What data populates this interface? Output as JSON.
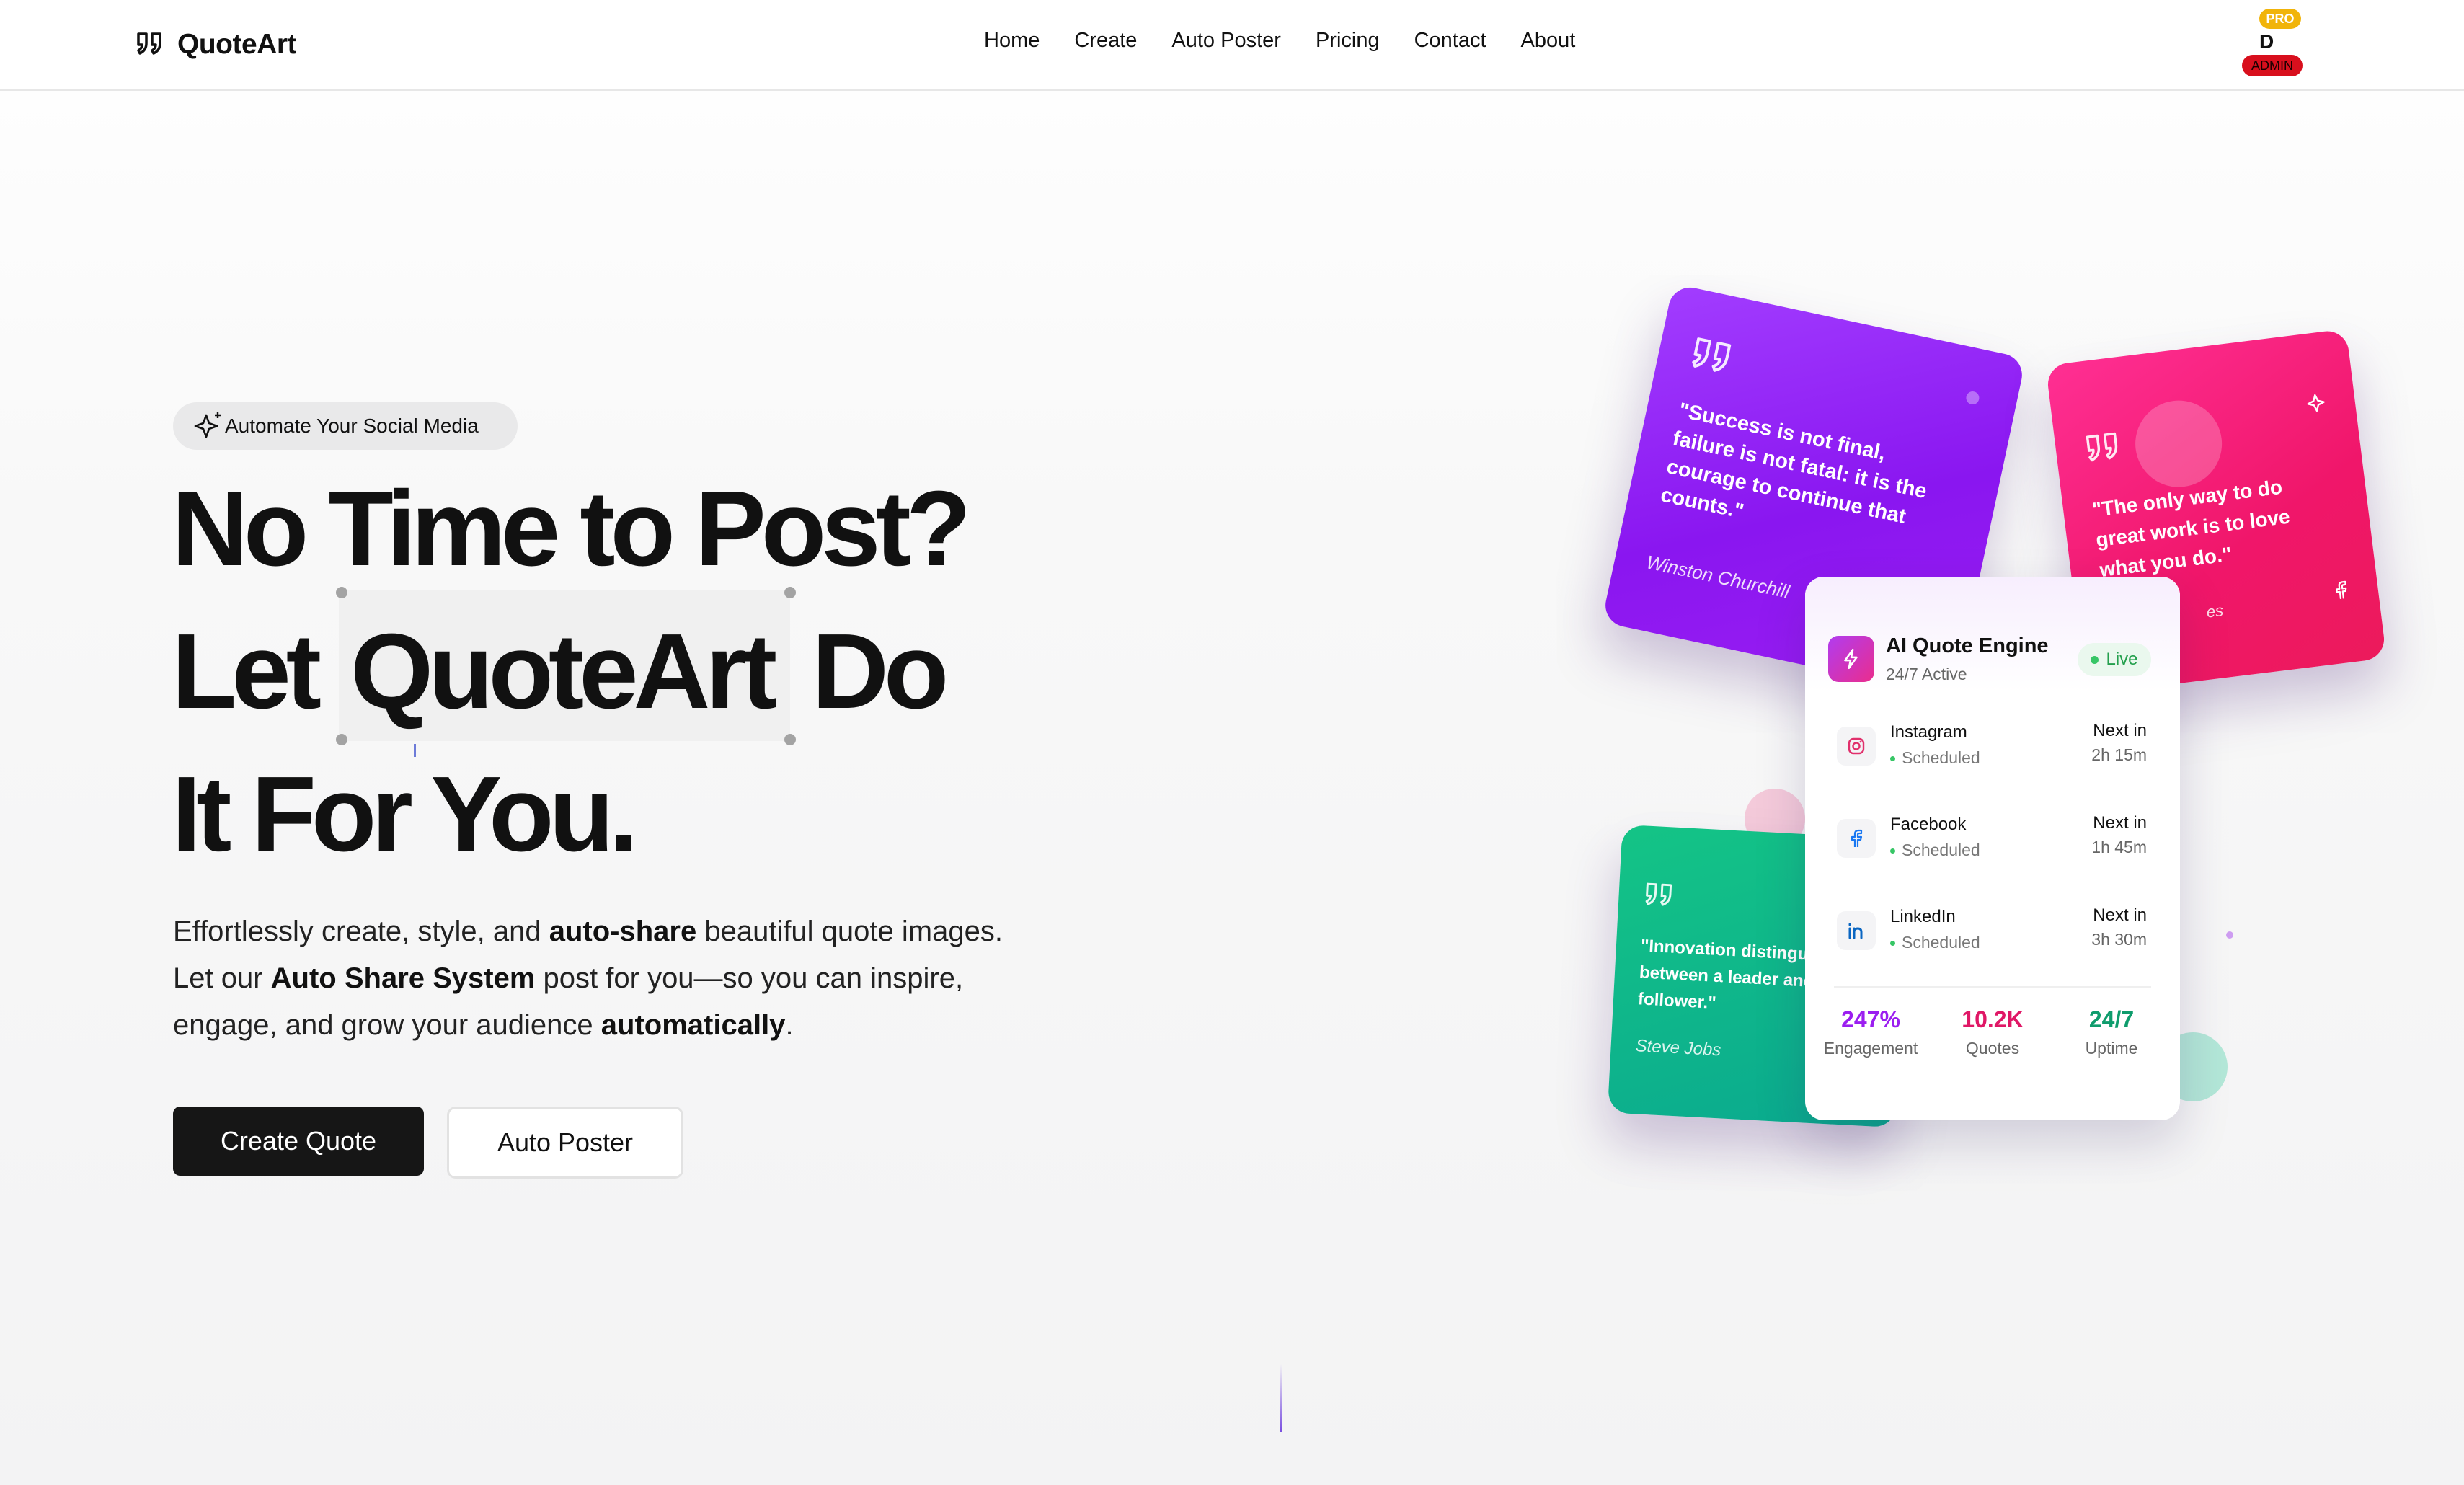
{
  "nav": {
    "brand": "QuoteArt",
    "links": [
      "Home",
      "Create",
      "Auto Poster",
      "Pricing",
      "Contact",
      "About"
    ],
    "user": {
      "pro_badge": "PRO",
      "initial": "D",
      "admin_badge": "ADMIN"
    }
  },
  "hero": {
    "eyebrow": "Automate Your Social Media",
    "headline_line1": "No Time to Post?",
    "headline_let": "Let",
    "headline_brand": "QuoteArt",
    "headline_do": "Do",
    "headline_line3": "It For You.",
    "description": {
      "p1": "Effortlessly create, style, and ",
      "b1": "auto-share",
      "p2": " beautiful quote images.",
      "p3": "Let our ",
      "b2": "Auto Share System",
      "p4": " post for you—so you can inspire,",
      "p5": "engage, and grow your audience ",
      "b3": "automatically",
      "p6": "."
    },
    "cta_primary": "Create Quote",
    "cta_secondary": "Auto Poster"
  },
  "cards": {
    "purple": {
      "quote": "\"Success is not final, failure is not fatal: it is the courage to continue that counts.\"",
      "author": "Winston Churchill"
    },
    "pink": {
      "quote": "\"The only way to do great work is to love what you do.\"",
      "author": "es"
    },
    "green": {
      "quote": "\"Innovation distinguishes between a leader and a follower.\"",
      "author": "Steve Jobs"
    }
  },
  "engine": {
    "title": "AI Quote Engine",
    "subtitle": "24/7 Active",
    "status": "Live",
    "schedules": [
      {
        "platform": "Instagram",
        "status": "Scheduled",
        "next_label": "Next in",
        "next_time": "2h 15m",
        "icon": "instagram-icon"
      },
      {
        "platform": "Facebook",
        "status": "Scheduled",
        "next_label": "Next in",
        "next_time": "1h 45m",
        "icon": "facebook-icon"
      },
      {
        "platform": "LinkedIn",
        "status": "Scheduled",
        "next_label": "Next in",
        "next_time": "3h 30m",
        "icon": "linkedin-icon"
      }
    ],
    "stats": [
      {
        "value": "247%",
        "label": "Engagement",
        "color": "#9b1ef0"
      },
      {
        "value": "10.2K",
        "label": "Quotes",
        "color": "#e01766"
      },
      {
        "value": "24/7",
        "label": "Uptime",
        "color": "#0e9c6c"
      }
    ]
  },
  "colors": {
    "accent_dark": "#161616",
    "purple": "#9b1ef0",
    "pink": "#f0166a",
    "green": "#10b487",
    "live": "#25a04e"
  }
}
